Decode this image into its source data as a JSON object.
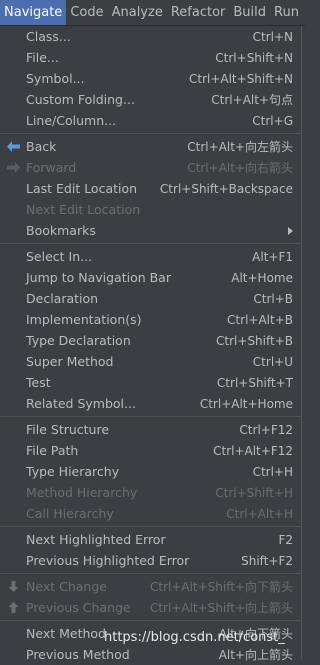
{
  "menubar": {
    "items": [
      "Navigate",
      "Code",
      "Analyze",
      "Refactor",
      "Build",
      "Run"
    ],
    "active_index": 0
  },
  "menu": {
    "sections": [
      [
        {
          "label": "Class...",
          "shortcut": "Ctrl+N",
          "enabled": true
        },
        {
          "label": "File...",
          "shortcut": "Ctrl+Shift+N",
          "enabled": true
        },
        {
          "label": "Symbol...",
          "shortcut": "Ctrl+Alt+Shift+N",
          "enabled": true
        },
        {
          "label": "Custom Folding...",
          "shortcut": "Ctrl+Alt+句点",
          "enabled": true
        },
        {
          "label": "Line/Column...",
          "shortcut": "Ctrl+G",
          "enabled": true
        }
      ],
      [
        {
          "label": "Back",
          "shortcut": "Ctrl+Alt+向左箭头",
          "enabled": true,
          "icon": "back-arrow-icon"
        },
        {
          "label": "Forward",
          "shortcut": "Ctrl+Alt+向右箭头",
          "enabled": false,
          "icon": "forward-arrow-icon"
        },
        {
          "label": "Last Edit Location",
          "shortcut": "Ctrl+Shift+Backspace",
          "enabled": true
        },
        {
          "label": "Next Edit Location",
          "shortcut": "",
          "enabled": false
        },
        {
          "label": "Bookmarks",
          "shortcut": "",
          "enabled": true,
          "submenu": true
        }
      ],
      [
        {
          "label": "Select In...",
          "shortcut": "Alt+F1",
          "enabled": true
        },
        {
          "label": "Jump to Navigation Bar",
          "shortcut": "Alt+Home",
          "enabled": true
        },
        {
          "label": "Declaration",
          "shortcut": "Ctrl+B",
          "enabled": true
        },
        {
          "label": "Implementation(s)",
          "shortcut": "Ctrl+Alt+B",
          "enabled": true
        },
        {
          "label": "Type Declaration",
          "shortcut": "Ctrl+Shift+B",
          "enabled": true
        },
        {
          "label": "Super Method",
          "shortcut": "Ctrl+U",
          "enabled": true
        },
        {
          "label": "Test",
          "shortcut": "Ctrl+Shift+T",
          "enabled": true
        },
        {
          "label": "Related Symbol...",
          "shortcut": "Ctrl+Alt+Home",
          "enabled": true
        }
      ],
      [
        {
          "label": "File Structure",
          "shortcut": "Ctrl+F12",
          "enabled": true
        },
        {
          "label": "File Path",
          "shortcut": "Ctrl+Alt+F12",
          "enabled": true
        },
        {
          "label": "Type Hierarchy",
          "shortcut": "Ctrl+H",
          "enabled": true
        },
        {
          "label": "Method Hierarchy",
          "shortcut": "Ctrl+Shift+H",
          "enabled": false
        },
        {
          "label": "Call Hierarchy",
          "shortcut": "Ctrl+Alt+H",
          "enabled": false
        }
      ],
      [
        {
          "label": "Next Highlighted Error",
          "shortcut": "F2",
          "enabled": true
        },
        {
          "label": "Previous Highlighted Error",
          "shortcut": "Shift+F2",
          "enabled": true
        }
      ],
      [
        {
          "label": "Next Change",
          "shortcut": "Ctrl+Alt+Shift+向下箭头",
          "enabled": false,
          "icon": "down-arrow-icon"
        },
        {
          "label": "Previous Change",
          "shortcut": "Ctrl+Alt+Shift+向上箭头",
          "enabled": false,
          "icon": "up-arrow-icon"
        }
      ],
      [
        {
          "label": "Next Method",
          "shortcut": "Alt+向下箭头",
          "enabled": true
        },
        {
          "label": "Previous Method",
          "shortcut": "Alt+向上箭头",
          "enabled": true
        }
      ]
    ]
  },
  "watermark": "https://blog.csdn.net/const_",
  "colors": {
    "background": "#3c3f41",
    "active_menubar": "#4b6eaf",
    "text": "#bbbbbb",
    "disabled_text": "#6e6e6e",
    "back_icon": "#4f9ee3"
  }
}
